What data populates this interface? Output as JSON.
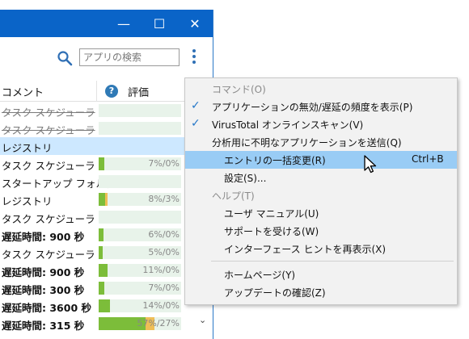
{
  "window": {
    "controls": {
      "minimize": "—",
      "maximize": "☐",
      "close": "✕"
    },
    "search_placeholder": "アプリの検索"
  },
  "table": {
    "header_comment": "コメント",
    "header_help": "?",
    "header_rating": "評価",
    "rows": [
      {
        "text": "タスク スケジューラ",
        "strike": true,
        "bold": false,
        "bar": true,
        "fill": 0,
        "fill2": 0,
        "pct": ""
      },
      {
        "text": "タスク スケジューラ",
        "strike": true,
        "bold": false,
        "bar": true,
        "fill": 0,
        "fill2": 0,
        "pct": ""
      },
      {
        "text": "レジストリ",
        "strike": false,
        "bold": false,
        "bar": false,
        "fill": 0,
        "fill2": 0,
        "pct": ""
      },
      {
        "text": "タスク スケジューラ",
        "strike": false,
        "bold": false,
        "bar": true,
        "fill": 0.07,
        "fill2": 0,
        "pct": "7%/0%"
      },
      {
        "text": "スタートアップ フォルダ",
        "strike": false,
        "bold": false,
        "bar": true,
        "fill": 0,
        "fill2": 0,
        "pct": ""
      },
      {
        "text": "レジストリ",
        "strike": false,
        "bold": false,
        "bar": true,
        "fill": 0.08,
        "fill2": 0.03,
        "pct": "8%/3%"
      },
      {
        "text": "タスク スケジューラ",
        "strike": false,
        "bold": false,
        "bar": true,
        "fill": 0,
        "fill2": 0,
        "pct": ""
      },
      {
        "text": "遅延時間: 900 秒",
        "strike": false,
        "bold": true,
        "bar": true,
        "fill": 0.06,
        "fill2": 0,
        "pct": "6%/0%"
      },
      {
        "text": "タスク スケジューラ",
        "strike": false,
        "bold": false,
        "bar": true,
        "fill": 0.05,
        "fill2": 0,
        "pct": "5%/0%"
      },
      {
        "text": "遅延時間: 900 秒",
        "strike": false,
        "bold": true,
        "bar": true,
        "fill": 0.11,
        "fill2": 0,
        "pct": "11%/0%"
      },
      {
        "text": "遅延時間: 300 秒",
        "strike": false,
        "bold": true,
        "bar": true,
        "fill": 0.07,
        "fill2": 0,
        "pct": "7%/0%"
      },
      {
        "text": "遅延時間: 3600 秒",
        "strike": false,
        "bold": true,
        "bar": true,
        "fill": 0.14,
        "fill2": 0,
        "pct": "14%/0%"
      },
      {
        "text": "遅延時間: 315 秒",
        "strike": false,
        "bold": true,
        "bar": true,
        "fill": 0.57,
        "fill2": 0.27,
        "pct": "57%/27%"
      }
    ]
  },
  "menu": {
    "items": [
      {
        "type": "section",
        "label": "コマンド(O)",
        "checked": false,
        "indent": false,
        "highlight": false,
        "shortcut": ""
      },
      {
        "type": "item",
        "label": "アプリケーションの無効/遅延の頻度を表示(P)",
        "checked": true,
        "indent": false,
        "highlight": false,
        "shortcut": ""
      },
      {
        "type": "item",
        "label": "VirusTotal オンラインスキャン(V)",
        "checked": true,
        "indent": false,
        "highlight": false,
        "shortcut": ""
      },
      {
        "type": "item",
        "label": "分析用に不明なアプリケーションを送信(Q)",
        "checked": false,
        "indent": false,
        "highlight": false,
        "shortcut": ""
      },
      {
        "type": "item",
        "label": "エントリの一括変更(R)",
        "checked": false,
        "indent": true,
        "highlight": true,
        "shortcut": "Ctrl+B"
      },
      {
        "type": "item",
        "label": "設定(S)...",
        "checked": false,
        "indent": true,
        "highlight": false,
        "shortcut": ""
      },
      {
        "type": "section",
        "label": "ヘルプ(T)",
        "checked": false,
        "indent": false,
        "highlight": false,
        "shortcut": ""
      },
      {
        "type": "item",
        "label": "ユーザ マニュアル(U)",
        "checked": false,
        "indent": true,
        "highlight": false,
        "shortcut": ""
      },
      {
        "type": "item",
        "label": "サポートを受ける(W)",
        "checked": false,
        "indent": true,
        "highlight": false,
        "shortcut": ""
      },
      {
        "type": "item",
        "label": "インターフェース ヒントを再表示(X)",
        "checked": false,
        "indent": true,
        "highlight": false,
        "shortcut": ""
      },
      {
        "type": "separator"
      },
      {
        "type": "item",
        "label": "ホームページ(Y)",
        "checked": false,
        "indent": true,
        "highlight": false,
        "shortcut": ""
      },
      {
        "type": "item",
        "label": "アップデートの確認(Z)",
        "checked": false,
        "indent": true,
        "highlight": false,
        "shortcut": ""
      }
    ]
  },
  "colors": {
    "titlebar": "#0a64c8",
    "bar_fill": "#7cbd3a",
    "bar_fill2": "#f0b43c",
    "menu_highlight": "#99ccf5",
    "check": "#2577c8"
  },
  "icons": {
    "search": "search-icon",
    "kebab": "kebab-menu-icon",
    "help": "help-icon",
    "check": "checkmark-icon",
    "cursor": "mouse-pointer-icon"
  }
}
